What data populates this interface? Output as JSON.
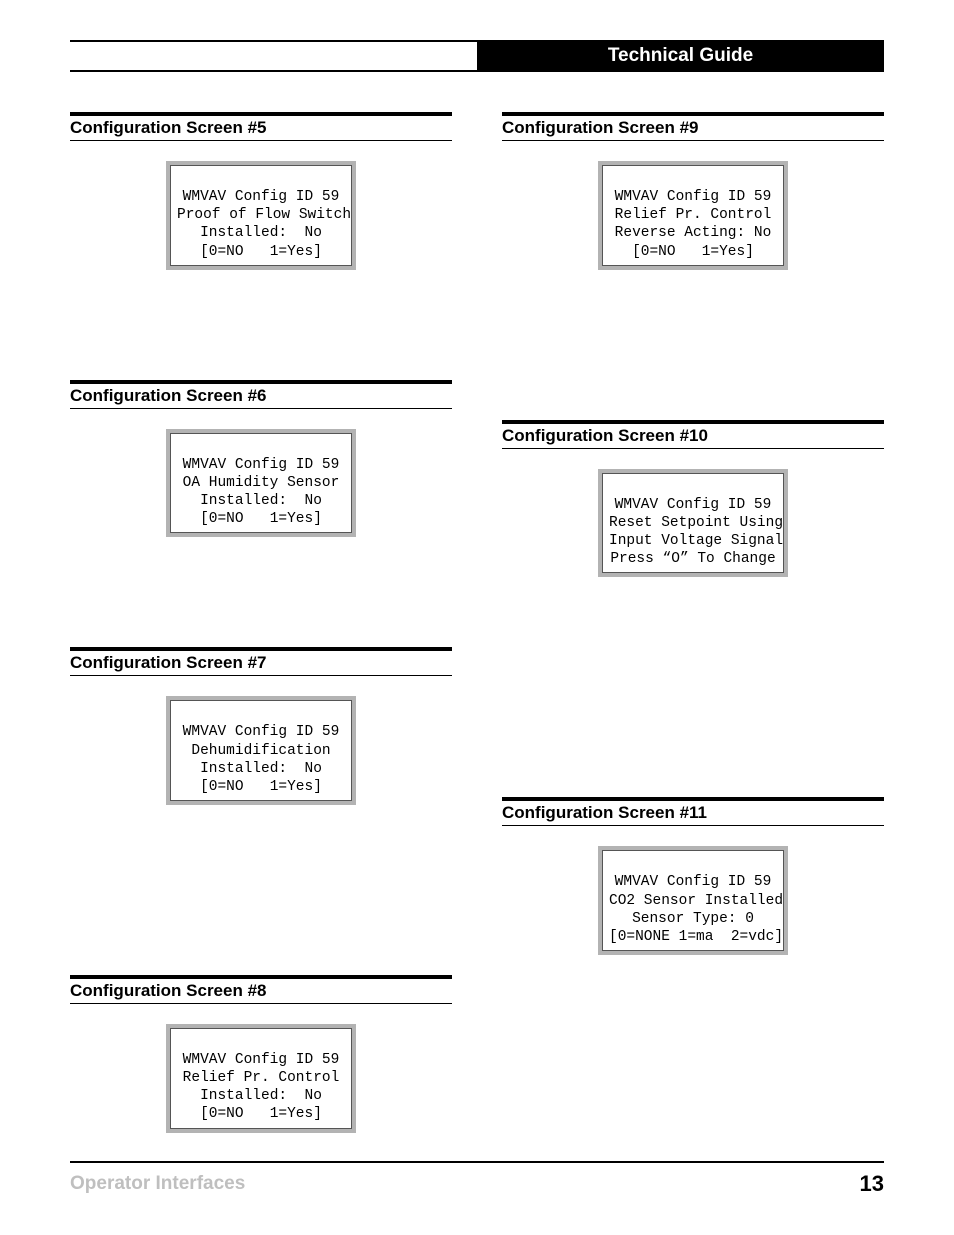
{
  "header": {
    "title": "Technical Guide"
  },
  "left_sections": [
    {
      "title": "Configuration Screen #5",
      "lines": [
        "WMVAV Config ID 59",
        "Proof of Flow Switch",
        "Installed:  No",
        "[0=NO   1=Yes]"
      ]
    },
    {
      "title": "Configuration Screen #6",
      "lines": [
        "WMVAV Config ID 59",
        "OA Humidity Sensor",
        "Installed:  No",
        "[0=NO   1=Yes]"
      ]
    },
    {
      "title": "Configuration Screen #7",
      "lines": [
        "WMVAV Config ID 59",
        "Dehumidification",
        "Installed:  No",
        "[0=NO   1=Yes]"
      ]
    },
    {
      "title": "Configuration Screen #8",
      "lines": [
        "WMVAV Config ID 59",
        "Relief Pr. Control",
        "Installed:  No",
        "[0=NO   1=Yes]"
      ]
    }
  ],
  "right_sections": [
    {
      "title": "Configuration Screen #9",
      "lines": [
        "WMVAV Config ID 59",
        "Relief Pr. Control",
        "Reverse Acting: No",
        "[0=NO   1=Yes]"
      ]
    },
    {
      "title": "Configuration Screen #10",
      "lines": [
        "WMVAV Config ID 59",
        "Reset Setpoint Using",
        "Input Voltage Signal",
        "Press “O” To Change"
      ]
    },
    {
      "title": "Configuration Screen #11",
      "lines": [
        "WMVAV Config ID 59",
        "CO2 Sensor Installed",
        "Sensor Type: 0",
        "[0=NONE 1=ma  2=vdc]"
      ]
    }
  ],
  "footer": {
    "left": "Operator Interfaces",
    "right": "13"
  }
}
